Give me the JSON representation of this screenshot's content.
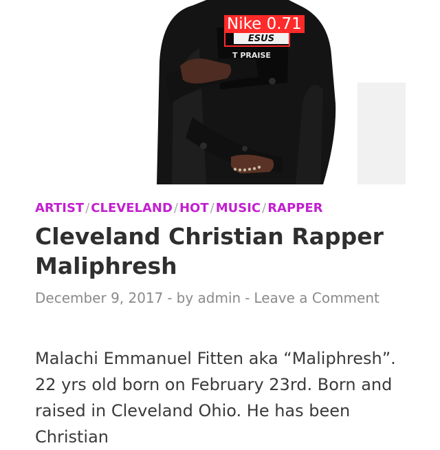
{
  "hero": {
    "shirt_text_top": "ESUS",
    "shirt_text_bottom": "T PRAISE",
    "detection": {
      "label": "Nike",
      "score": "0.71",
      "color": "#ff2a2a"
    }
  },
  "post": {
    "categories": [
      {
        "label": "ARTIST"
      },
      {
        "label": "CLEVELAND"
      },
      {
        "label": "HOT"
      },
      {
        "label": "MUSIC"
      },
      {
        "label": "RAPPER"
      }
    ],
    "category_separator": "/",
    "title": "Cleveland Christian Rapper Maliphresh",
    "date": "December 9, 2017",
    "meta_separator": "-",
    "author_prefix": "by",
    "author": "admin",
    "comment_link": "Leave a Comment",
    "body": "Malachi Emmanuel Fitten aka “Maliphresh”. 22 yrs old born on February 23rd. Born and raised in Cleveland Ohio. He has been Christian"
  },
  "colors": {
    "category": "#c21fd0",
    "title": "#2f2f2f",
    "meta": "#8a8a8a",
    "body": "#3a3a3a"
  }
}
